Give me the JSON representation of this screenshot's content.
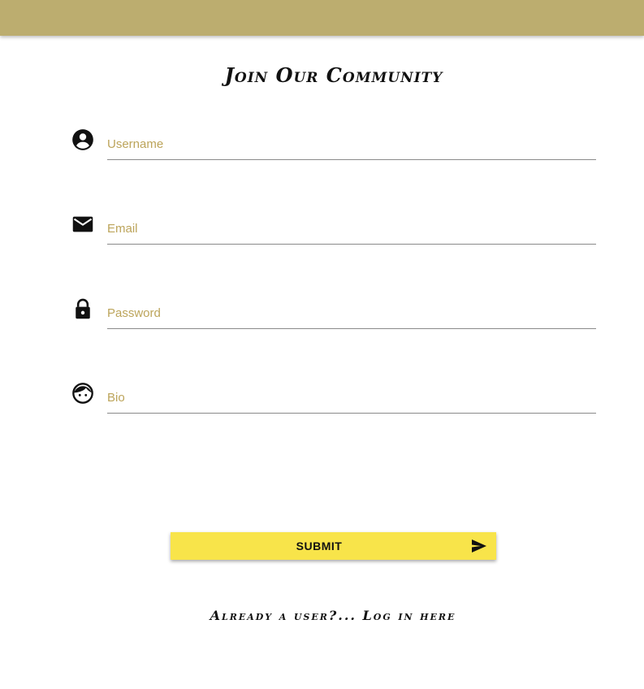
{
  "header": {
    "bar_color": "#bcad6f"
  },
  "page": {
    "title": "Join Our Community"
  },
  "form": {
    "fields": [
      {
        "icon": "account-circle-icon",
        "placeholder": "Username",
        "value": ""
      },
      {
        "icon": "mail-icon",
        "placeholder": "Email",
        "value": ""
      },
      {
        "icon": "lock-icon",
        "placeholder": "Password",
        "value": ""
      },
      {
        "icon": "face-icon",
        "placeholder": "Bio",
        "value": ""
      }
    ],
    "submit_label": "SUBMIT",
    "submit_icon": "send-icon",
    "submit_color": "#f8e44a",
    "placeholder_color": "#bca45a"
  },
  "footer": {
    "login_text": "Already a user?... Log in here"
  }
}
